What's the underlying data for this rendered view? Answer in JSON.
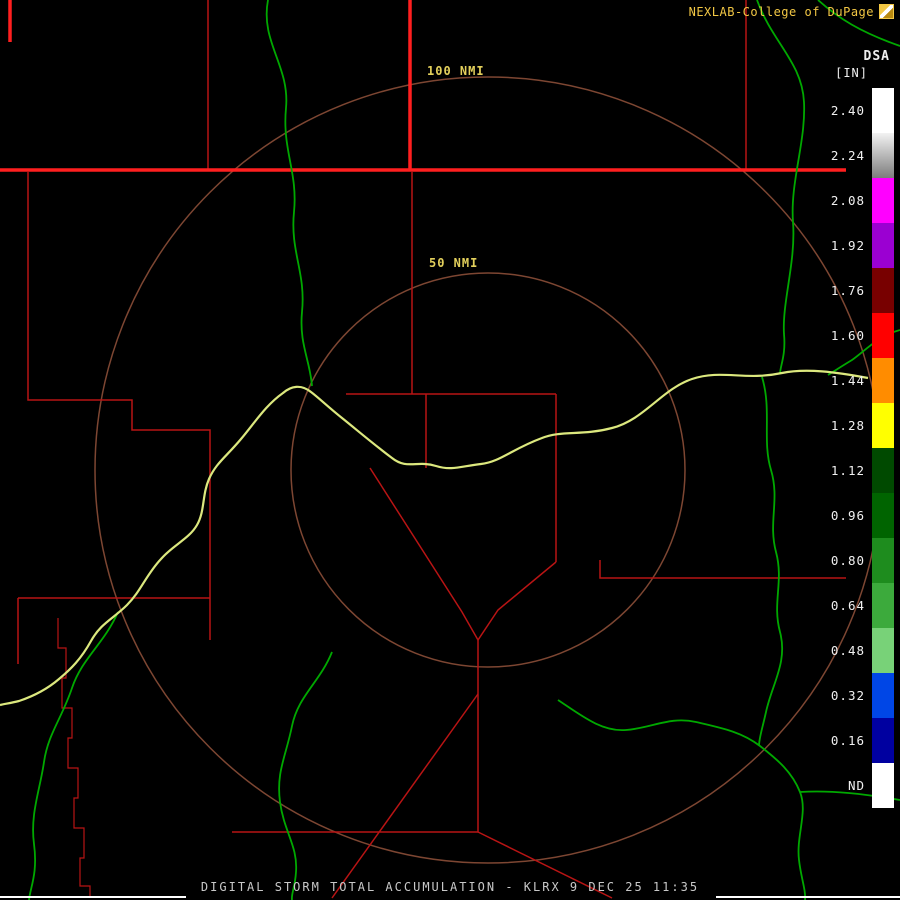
{
  "header": {
    "brand": "NEXLAB-College of DuPage",
    "product_code": "DSA",
    "units_label": "[IN]"
  },
  "map": {
    "radar_site": "KLRX",
    "range_rings": [
      {
        "label": "100 NMI"
      },
      {
        "label": "50 NMI"
      }
    ]
  },
  "colorbar": {
    "levels": [
      {
        "label": "2.40",
        "color": "#ffffff"
      },
      {
        "label": "2.24",
        "color": "#f2f2f2",
        "color2": "#7d7d7d"
      },
      {
        "label": "2.08",
        "color": "#ff00ff"
      },
      {
        "label": "1.92",
        "color": "#9b00d2"
      },
      {
        "label": "1.76",
        "color": "#780000"
      },
      {
        "label": "1.60",
        "color": "#ff0000"
      },
      {
        "label": "1.44",
        "color": "#ff8c00"
      },
      {
        "label": "1.28",
        "color": "#ffff00"
      },
      {
        "label": "1.12",
        "color": "#004a00"
      },
      {
        "label": "0.96",
        "color": "#006400"
      },
      {
        "label": "0.80",
        "color": "#1e8c1e"
      },
      {
        "label": "0.64",
        "color": "#3caa3c"
      },
      {
        "label": "0.48",
        "color": "#78d278"
      },
      {
        "label": "0.32",
        "color": "#0046e6"
      },
      {
        "label": "0.16",
        "color": "#0000a0"
      },
      {
        "label": "ND",
        "color": "#ffffff"
      }
    ]
  },
  "footer": {
    "title": "DIGITAL STORM TOTAL ACCUMULATION - KLRX 9 DEC 25 11:35"
  },
  "colors": {
    "background": "#000000",
    "state_border": "#ff1f1f",
    "county_border": "#b81414",
    "river": "#00a800",
    "highlighted_river": "#dce87e",
    "range_ring": "#7d4632",
    "ring_label": "#e3d05c",
    "brand": "#f2c744",
    "label_text": "#f0f0f0",
    "title_text": "#c8c8c8",
    "frame": "#ffffff"
  }
}
